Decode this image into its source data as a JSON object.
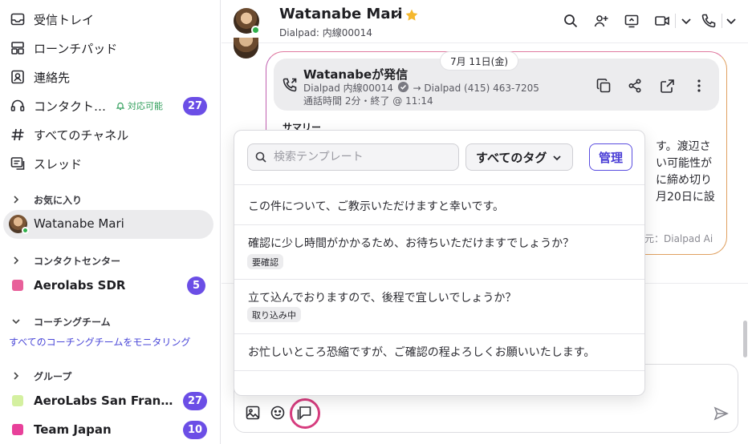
{
  "sidebar": {
    "nav": [
      {
        "label": "受信トレイ",
        "icon": "inbox-icon"
      },
      {
        "label": "ローンチパッド",
        "icon": "launchpad-icon"
      },
      {
        "label": "連絡先",
        "icon": "contacts-icon"
      },
      {
        "label": "コンタクト…",
        "icon": "headset-icon",
        "status": "対応可能",
        "badge": "27"
      },
      {
        "label": "すべてのチャネル",
        "icon": "hash-icon"
      },
      {
        "label": "スレッド",
        "icon": "threads-icon"
      }
    ],
    "favorites": {
      "title": "お気に入り",
      "items": [
        {
          "label": "Watanabe Mari"
        }
      ]
    },
    "contact_center": {
      "title": "コンタクトセンター",
      "items": [
        {
          "label": "Aerolabs SDR",
          "badge": "5",
          "color": "#e8609a"
        }
      ]
    },
    "coaching": {
      "title": "コーチングチーム",
      "link": "すべてのコーチングチームをモニタリング"
    },
    "groups": {
      "title": "グループ",
      "items": [
        {
          "label": "AeroLabs San Francis...",
          "badge": "27",
          "color": "#d4f0a0"
        },
        {
          "label": "Team Japan",
          "badge": "10",
          "color": "#e8409a"
        }
      ]
    }
  },
  "header": {
    "name": "Watanabe Mari",
    "subtitle": "Dialpad: 内線00014",
    "actions": [
      "search-icon",
      "add-person-icon",
      "share-screen-icon",
      "video-icon",
      "phone-icon"
    ]
  },
  "call": {
    "date": "7月 11日(金)",
    "title": "Watanabeが発信",
    "from": "Dialpad 内線00014",
    "to": "Dialpad (415) 463-7205",
    "meta": "通話時間 2分・終了 @ 11:14",
    "summary_label": "サマリー",
    "summary_fragments": [
      "す。渡辺さ",
      "い可能性が",
      "に締め切り",
      "月20日に設"
    ],
    "source": "元：Dialpad Ai"
  },
  "template_popup": {
    "search_placeholder": "検索テンプレート",
    "tag_filter": "すべてのタグ",
    "manage_label": "管理",
    "templates": [
      {
        "text": "この件について、ご教示いただけますと幸いです。",
        "tag": ""
      },
      {
        "text": "確認に少し時間がかかるため、お待ちいただけますでしょうか？",
        "tag": "要確認"
      },
      {
        "text": "立て込んでおりますので、後程で宜しいでしょうか？",
        "tag": "取り込み中"
      },
      {
        "text": "お忙しいところ恐縮ですが、ご確認の程よろしくお願いいたします。",
        "tag": ""
      }
    ]
  },
  "colors": {
    "accent": "#6b4ee6",
    "online": "#2fb04a",
    "highlight_ring": "#d63c7e",
    "star": "#f5b82e"
  }
}
